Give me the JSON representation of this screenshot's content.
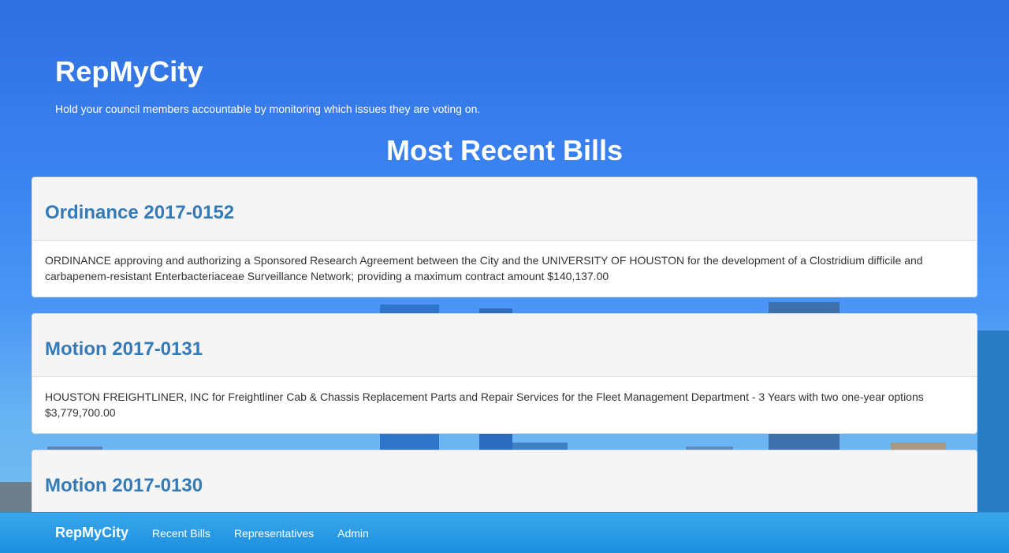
{
  "hero": {
    "title": "RepMyCity",
    "tagline": "Hold your council members accountable by monitoring which issues they are voting on."
  },
  "section_title": "Most Recent Bills",
  "bills": [
    {
      "title": "Ordinance 2017-0152",
      "description": "ORDINANCE approving and authorizing a Sponsored Research Agreement between the City and the UNIVERSITY OF HOUSTON for the development of a Clostridium difficile and carbapenem-resistant Enterbacteriaceae Surveillance Network; providing a maximum contract amount $140,137.00"
    },
    {
      "title": "Motion 2017-0131",
      "description": "HOUSTON FREIGHTLINER, INC for Freightliner Cab & Chassis Replacement Parts and Repair Services for the Fleet Management Department - 3 Years with two one-year options $3,779,700.00"
    },
    {
      "title": "Motion 2017-0130",
      "description": ""
    }
  ],
  "navbar": {
    "brand": "RepMyCity",
    "links": [
      "Recent Bills",
      "Representatives",
      "Admin"
    ]
  }
}
